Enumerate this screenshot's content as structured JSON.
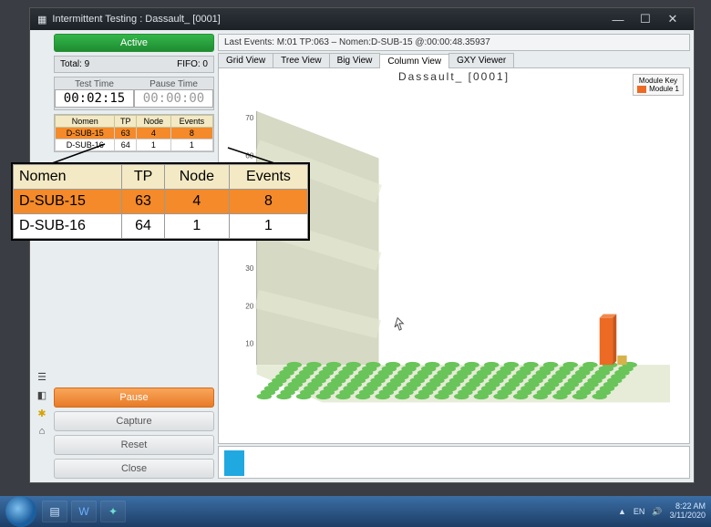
{
  "window": {
    "title": "Intermittent Testing : Dassault_ [0001]"
  },
  "statusbar": {
    "label": "Active"
  },
  "totals": {
    "total_label": "Total: 9",
    "fifo_label": "FIFO: 0"
  },
  "times": {
    "test_label": "Test Time",
    "test_value": "00:02:15",
    "pause_label": "Pause Time",
    "pause_value": "00:00:00"
  },
  "table": {
    "headers": {
      "nomen": "Nomen",
      "tp": "TP",
      "node": "Node",
      "events": "Events"
    },
    "rows": [
      {
        "nomen": "D-SUB-15",
        "tp": "63",
        "node": "4",
        "events": "8",
        "selected": true
      },
      {
        "nomen": "D-SUB-16",
        "tp": "64",
        "node": "1",
        "events": "1",
        "selected": false
      }
    ]
  },
  "buttons": {
    "pause": "Pause",
    "capture": "Capture",
    "reset": "Reset",
    "close": "Close"
  },
  "lastevents": "Last Events: M:01 TP:063 – Nomen:D-SUB-15  @:00:00:48.35937",
  "tabs": {
    "grid": "Grid View",
    "tree": "Tree View",
    "big": "Big View",
    "column": "Column View",
    "gxy": "GXY Viewer"
  },
  "chart": {
    "title": "Dassault_  [0001]",
    "legend_title": "Module Key",
    "legend_item": "Module 1"
  },
  "chart_data": {
    "type": "bar",
    "title": "Dassault_ [0001]",
    "ylabel": "",
    "ylim": [
      0,
      70
    ],
    "yticks": [
      10,
      20,
      30,
      40,
      50,
      60,
      70
    ],
    "series": [
      {
        "name": "D-SUB-15",
        "value": 8,
        "module": 1
      },
      {
        "name": "D-SUB-16",
        "value": 1,
        "module": 1
      }
    ],
    "legend": [
      "Module 1"
    ]
  },
  "taskbar": {
    "lang": "EN",
    "time": "8:22 AM",
    "date": "3/11/2020"
  }
}
